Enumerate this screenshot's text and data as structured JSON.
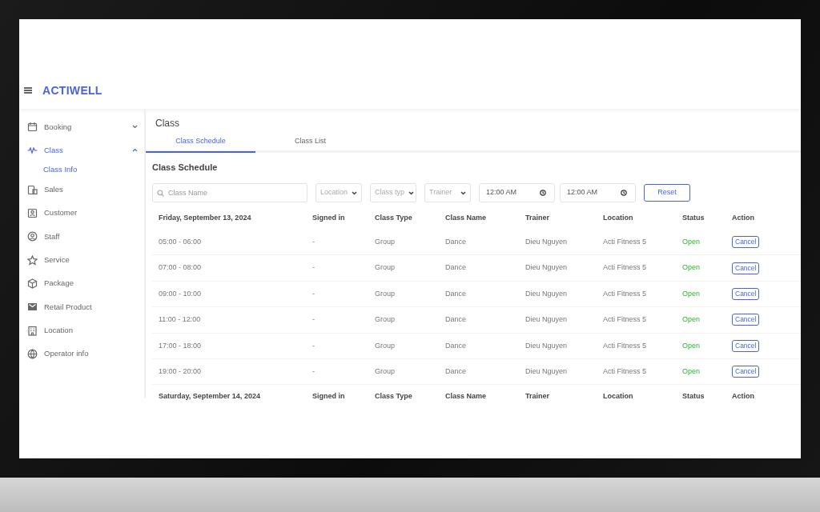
{
  "header": {
    "logo": "ACTIWELL"
  },
  "sidebar": {
    "items": [
      {
        "label": "Booking",
        "selected": false,
        "expanded": false
      },
      {
        "label": "Class",
        "selected": true,
        "expanded": true,
        "children": [
          {
            "label": "Class Info",
            "selected": true
          }
        ]
      },
      {
        "label": "Sales",
        "selected": false
      },
      {
        "label": "Customer",
        "selected": false
      },
      {
        "label": "Staff",
        "selected": false
      },
      {
        "label": "Service",
        "selected": false
      },
      {
        "label": "Package",
        "selected": false
      },
      {
        "label": "Retail Product",
        "selected": false
      },
      {
        "label": "Location",
        "selected": false
      },
      {
        "label": "Operator info",
        "selected": false
      }
    ]
  },
  "page": {
    "title": "Class",
    "tabs": [
      {
        "label": "Class Schedule",
        "selected": true
      },
      {
        "label": "Class List",
        "selected": false
      }
    ],
    "section_title": "Class Schedule",
    "filters": {
      "search": {
        "placeholder": "Class Name"
      },
      "selects": [
        {
          "placeholder": "Location"
        },
        {
          "placeholder": "Class typ"
        },
        {
          "placeholder": "Trainer"
        }
      ],
      "times": [
        {
          "value": "12:00 AM"
        },
        {
          "value": "12:00 AM"
        }
      ],
      "reset_button": "Reset"
    },
    "schedule": [
      {
        "date": "Friday, September 13, 2024",
        "columns": [
          "Signed in",
          "Class Type",
          "Class Name",
          "Trainer",
          "Location",
          "Status",
          "Action"
        ],
        "rows": [
          {
            "time": "05:00 - 06:00",
            "signed_in": "-",
            "class_type": "Group",
            "class_name": "Dance",
            "trainer": "Dieu Nguyen",
            "location": "Acti Fitness 5",
            "status": "Open",
            "action": "Cancel"
          },
          {
            "time": "07:00 - 08:00",
            "signed_in": "-",
            "class_type": "Group",
            "class_name": "Dance",
            "trainer": "Dieu Nguyen",
            "location": "Acti Fitness 5",
            "status": "Open",
            "action": "Cancel"
          },
          {
            "time": "09:00 - 10:00",
            "signed_in": "-",
            "class_type": "Group",
            "class_name": "Dance",
            "trainer": "Dieu Nguyen",
            "location": "Acti Fitness 5",
            "status": "Open",
            "action": "Cancel"
          },
          {
            "time": "11:00 - 12:00",
            "signed_in": "-",
            "class_type": "Group",
            "class_name": "Dance",
            "trainer": "Dieu Nguyen",
            "location": "Acti Fitness 5",
            "status": "Open",
            "action": "Cancel"
          },
          {
            "time": "17:00 - 18:00",
            "signed_in": "-",
            "class_type": "Group",
            "class_name": "Dance",
            "trainer": "Dieu Nguyen",
            "location": "Acti Fitness 5",
            "status": "Open",
            "action": "Cancel"
          },
          {
            "time": "19:00 - 20:00",
            "signed_in": "-",
            "class_type": "Group",
            "class_name": "Dance",
            "trainer": "Dieu Nguyen",
            "location": "Acti Fitness 5",
            "status": "Open",
            "action": "Cancel"
          }
        ]
      },
      {
        "date": "Saturday, September 14, 2024",
        "columns": [
          "Signed in",
          "Class Type",
          "Class Name",
          "Trainer",
          "Location",
          "Status",
          "Action"
        ]
      }
    ]
  }
}
